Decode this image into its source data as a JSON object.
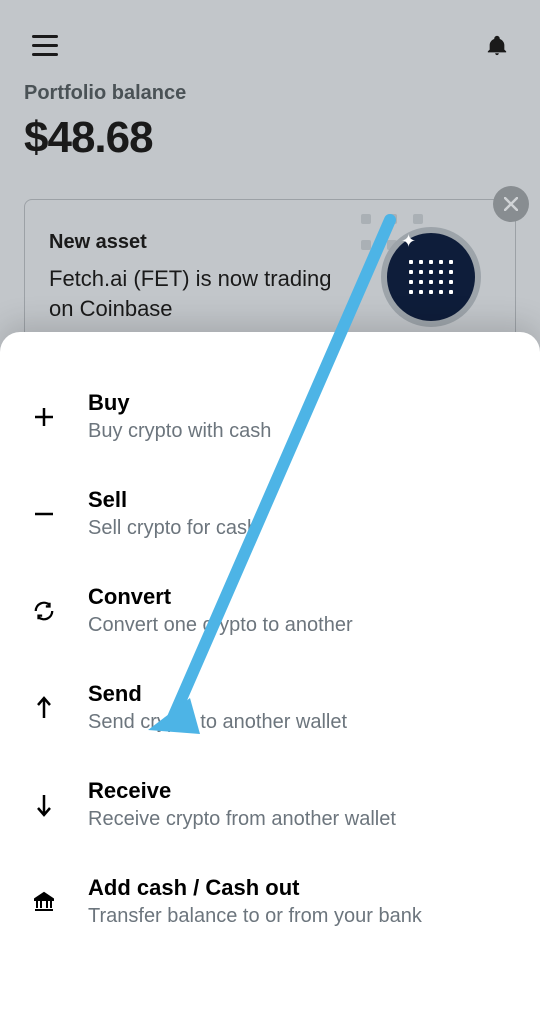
{
  "header": {
    "portfolio_label": "Portfolio balance",
    "portfolio_balance": "$48.68"
  },
  "promo": {
    "title": "New asset",
    "body": "Fetch.ai (FET) is now trading on Coinbase"
  },
  "actions": [
    {
      "id": "buy",
      "title": "Buy",
      "subtitle": "Buy crypto with cash",
      "icon": "plus"
    },
    {
      "id": "sell",
      "title": "Sell",
      "subtitle": "Sell crypto for cash",
      "icon": "minus"
    },
    {
      "id": "convert",
      "title": "Convert",
      "subtitle": "Convert one crypto to another",
      "icon": "convert"
    },
    {
      "id": "send",
      "title": "Send",
      "subtitle": "Send crypto to another wallet",
      "icon": "arrow-up"
    },
    {
      "id": "receive",
      "title": "Receive",
      "subtitle": "Receive crypto from another wallet",
      "icon": "arrow-down"
    },
    {
      "id": "add-cash",
      "title": "Add cash / Cash out",
      "subtitle": "Transfer balance to or from your bank",
      "icon": "bank"
    }
  ]
}
